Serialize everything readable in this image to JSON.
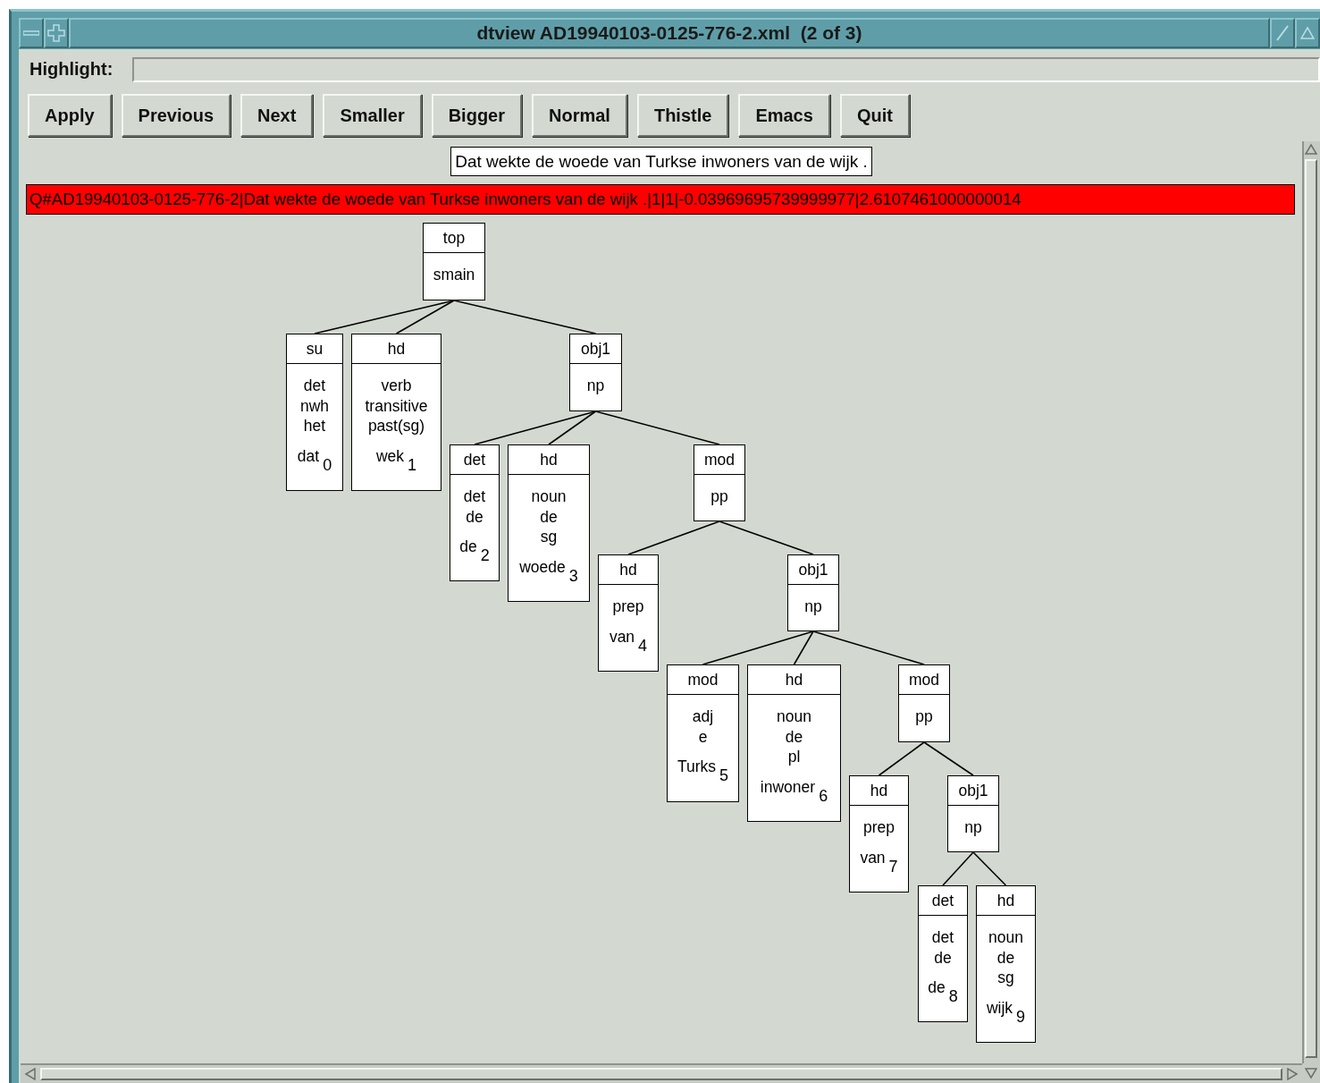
{
  "window": {
    "title": "dtview AD19940103-0125-776-2.xml  (2 of 3)"
  },
  "highlight": {
    "label": "Highlight:"
  },
  "buttons": [
    "Apply",
    "Previous",
    "Next",
    "Smaller",
    "Bigger",
    "Normal",
    "Thistle",
    "Emacs",
    "Quit"
  ],
  "sentence": "Dat wekte de woede van Turkse inwoners van de wijk .",
  "info_line": "Q#AD19940103-0125-776-2|Dat wekte de woede van Turkse inwoners van de wijk .|1|1|-0.03969695739999977|2.6107461000000014",
  "tree": {
    "label": "top",
    "lines": [
      "smain"
    ],
    "children": [
      {
        "label": "su",
        "lines": [
          "det",
          "nwh",
          "het"
        ],
        "word": "dat",
        "index": "0"
      },
      {
        "label": "hd",
        "lines": [
          "verb",
          "transitive",
          "past(sg)"
        ],
        "word": "wek",
        "index": "1"
      },
      {
        "label": "obj1",
        "lines": [
          "np"
        ],
        "children": [
          {
            "label": "det",
            "lines": [
              "det",
              "de"
            ],
            "word": "de",
            "index": "2"
          },
          {
            "label": "hd",
            "lines": [
              "noun",
              "de",
              "sg"
            ],
            "word": "woede",
            "index": "3"
          },
          {
            "label": "mod",
            "lines": [
              "pp"
            ],
            "children": [
              {
                "label": "hd",
                "lines": [
                  "prep"
                ],
                "word": "van",
                "index": "4"
              },
              {
                "label": "obj1",
                "lines": [
                  "np"
                ],
                "children": [
                  {
                    "label": "mod",
                    "lines": [
                      "adj",
                      "e"
                    ],
                    "word": "Turks",
                    "index": "5"
                  },
                  {
                    "label": "hd",
                    "lines": [
                      "noun",
                      "de",
                      "pl"
                    ],
                    "word": "inwoner",
                    "index": "6"
                  },
                  {
                    "label": "mod",
                    "lines": [
                      "pp"
                    ],
                    "children": [
                      {
                        "label": "hd",
                        "lines": [
                          "prep"
                        ],
                        "word": "van",
                        "index": "7"
                      },
                      {
                        "label": "obj1",
                        "lines": [
                          "np"
                        ],
                        "children": [
                          {
                            "label": "det",
                            "lines": [
                              "det",
                              "de"
                            ],
                            "word": "de",
                            "index": "8"
                          },
                          {
                            "label": "hd",
                            "lines": [
                              "noun",
                              "de",
                              "sg"
                            ],
                            "word": "wijk",
                            "index": "9"
                          }
                        ]
                      }
                    ]
                  }
                ]
              }
            ]
          }
        ]
      }
    ]
  }
}
